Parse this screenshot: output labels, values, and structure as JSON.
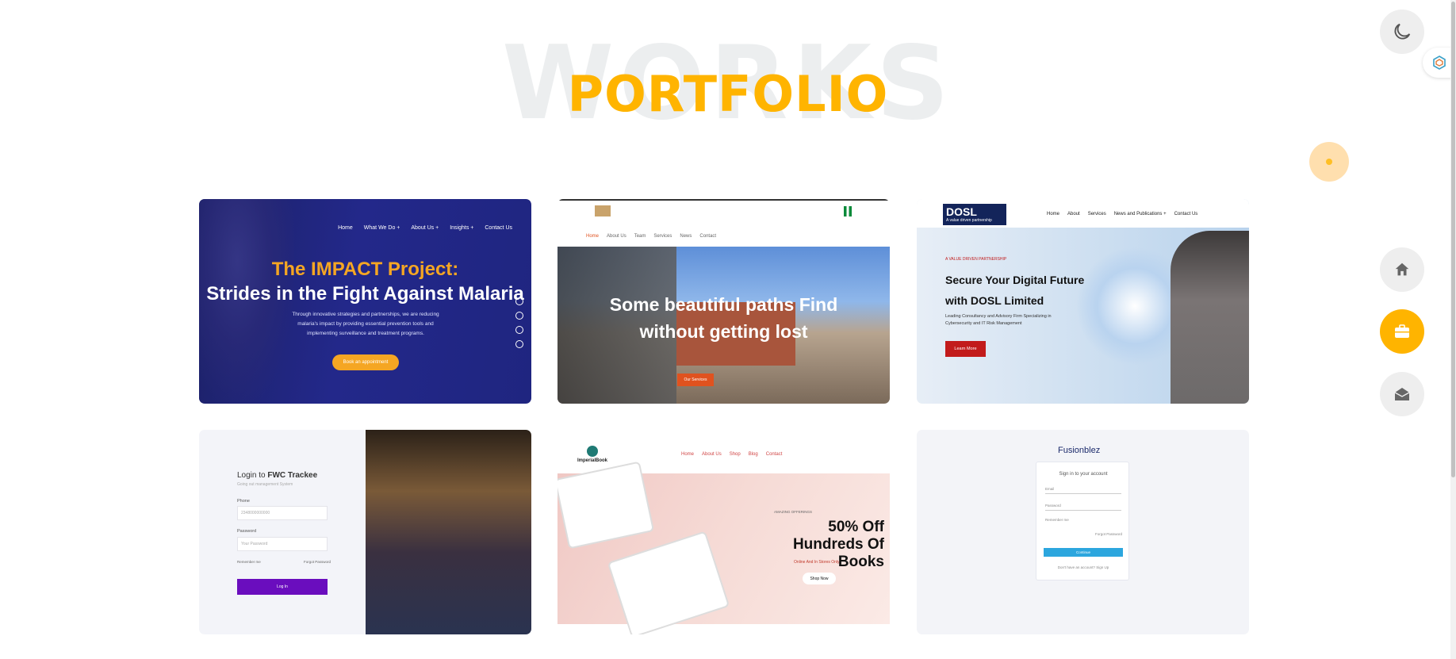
{
  "heading": {
    "background_word": "WORKS",
    "title": "PORTFOLIO"
  },
  "cards": {
    "impact": {
      "nav": [
        "Home",
        "What We Do +",
        "About Us +",
        "Insights +",
        "Contact Us"
      ],
      "headline_1": "The IMPACT Project:",
      "headline_2": "Strides in the Fight Against Malaria",
      "body": "Through innovative strategies and partnerships, we are reducing malaria's impact by providing essential prevention tools and implementing surveillance and treatment programs.",
      "button": "Book an appointment",
      "slides": [
        "1",
        "2",
        "3",
        "4"
      ]
    },
    "logistics": {
      "nav": [
        "Home",
        "About Us",
        "Team",
        "Services",
        "News",
        "Contact"
      ],
      "headline": "Some beautiful paths Find without getting lost",
      "button": "Our Services"
    },
    "dosl": {
      "logo": "DOSL",
      "logo_tagline": "A value driven partnership",
      "nav": [
        "Home",
        "About",
        "Services",
        "News and Publications +",
        "Contact Us"
      ],
      "kicker": "A VALUE DRIVEN PARTNERSHIP",
      "headline": "Secure Your Digital Future with DOSL Limited",
      "body": "Leading Consultancy and Advisory Firm Specializing in Cybersecurity and IT Risk Management",
      "button": "Learn More"
    },
    "fwc": {
      "title_prefix": "Login to ",
      "title_brand": "FWC Trackee",
      "subtitle": "Going out management System",
      "phone_label": "Phone",
      "phone_value": "2348000000000",
      "password_label": "Password",
      "password_placeholder": "Your Password",
      "remember": "Remember me",
      "forgot": "Forgot Password",
      "button": "Log In"
    },
    "books": {
      "logo": "ImperialBook",
      "nav": [
        "Home",
        "About Us",
        "Shop",
        "Blog",
        "Contact"
      ],
      "kicker": "AMAZING OFFERINGS",
      "headline": "50% Off Hundreds Of Books",
      "subline": "Online And In Stores Only",
      "button": "Shop Now"
    },
    "fusion": {
      "logo": "Fusionblez",
      "title": "Sign in to your account",
      "email": "Email",
      "password": "Password",
      "remember": "Remember me",
      "forgot": "Forgot Password",
      "button": "Continue",
      "footer": "Don't have an account? Sign Up"
    }
  },
  "fabs": {
    "theme": "moon-icon",
    "home": "home-icon",
    "portfolio": "briefcase-icon",
    "contact": "envelope-icon"
  }
}
